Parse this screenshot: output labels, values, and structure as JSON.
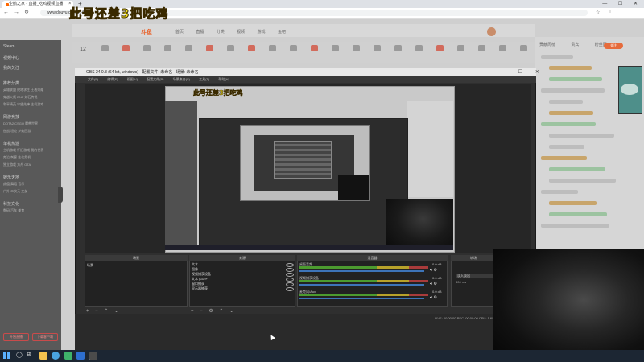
{
  "overlay_title": "此号还差3把吃鸡",
  "browser": {
    "tab_title": "企鹅之家 - 直播_吃鸡视频直播",
    "tab_close": "×",
    "new_tab": "+",
    "window_controls": "— ☐ ✕",
    "nav": {
      "back": "←",
      "forward": "→",
      "reload": "↻"
    },
    "url": "www.douyu.com/514976",
    "right_icons": "☆ ⋮"
  },
  "douyu": {
    "logo": "斗鱼",
    "nav_text": "首页 直播 分类 视频 游戏 鱼吧",
    "date": "12",
    "categories": [
      "",
      "",
      "",
      "",
      "",
      "",
      "",
      "",
      "",
      "",
      "",
      "",
      "",
      "",
      "",
      "",
      "",
      "",
      "",
      "",
      ""
    ],
    "right_tabs": "贡献周榜 贵宾 粉丝团",
    "follow_label": "关注"
  },
  "sidebar": {
    "top_items": [
      "Steam",
      "视频中心",
      "我的关注"
    ],
    "sections": [
      {
        "heading": "推荐分类",
        "items": [
          "英雄联盟 绝地求生 王者荣耀",
          "穿越火线 DNF 炉石传说",
          "和平精英 守望先锋 主机游戏"
        ]
      },
      {
        "heading": "网游竞技",
        "items": [
          "DOTA2 CSGO 魔兽世界",
          "逆战 坦克 梦幻西游"
        ]
      },
      {
        "heading": "单机热游",
        "items": [
          "主机游戏 怀旧游戏 我的世界",
          "鬼泣 刺客 生化危机",
          "独立游戏 方舟 GTA"
        ]
      },
      {
        "heading": "娱乐天地",
        "items": [
          "颜值 舞蹈 音乐",
          "户外 二次元 交友"
        ]
      },
      {
        "heading": "科技文化",
        "items": [
          "数码 汽车 美食"
        ]
      }
    ],
    "buttons": [
      "开始直播",
      "下载客户端"
    ]
  },
  "obs": {
    "title": "OBS 24.0.3 (64-bit, windows) - 配置文件: 未命名 - 场景: 未命名",
    "controls": "— ☐ ✕",
    "menu": [
      "文件(F)",
      "编辑(E)",
      "视图(V)",
      "配置文件(P)",
      "场景集合(S)",
      "工具(T)",
      "帮助(H)"
    ],
    "docks": {
      "scenes_header": "场景",
      "sources_header": "来源",
      "mixer_header": "混音器",
      "transitions_header": "转场"
    },
    "scenes": [
      "场景"
    ],
    "sources": [
      "文本",
      "图像",
      "视频捕获设备",
      "文本 (GDI+)",
      "窗口捕获",
      "显示器捕获"
    ],
    "footer_controls": "+ − ⌃ ⌄",
    "sources_footer": "+ − ⚙ ⌃ ⌄",
    "mixer": [
      {
        "name": "桌面音频",
        "db": "0.0 dB"
      },
      {
        "name": "视频捕获设备",
        "db": "0.0 dB"
      },
      {
        "name": "麦克风/Aux",
        "db": "0.0 dB"
      }
    ],
    "transition": "淡入淡出",
    "duration": "300 ms",
    "status": "LIVE: 00:00:00  REC: 00:00:00  CPU: 1.6%, 30.00 fps"
  },
  "nested": {
    "title": "此号还差3把吃鸡"
  },
  "taskbar": {
    "search": "◯",
    "taskview": "⧉"
  },
  "colors": {
    "accent_douyu": "#e8652f",
    "overlay_yellow": "#f5e31a",
    "obs_dark": "#2f2f2f",
    "mixer_green": "#4c9b2f",
    "taskbar": "#1c2633"
  }
}
